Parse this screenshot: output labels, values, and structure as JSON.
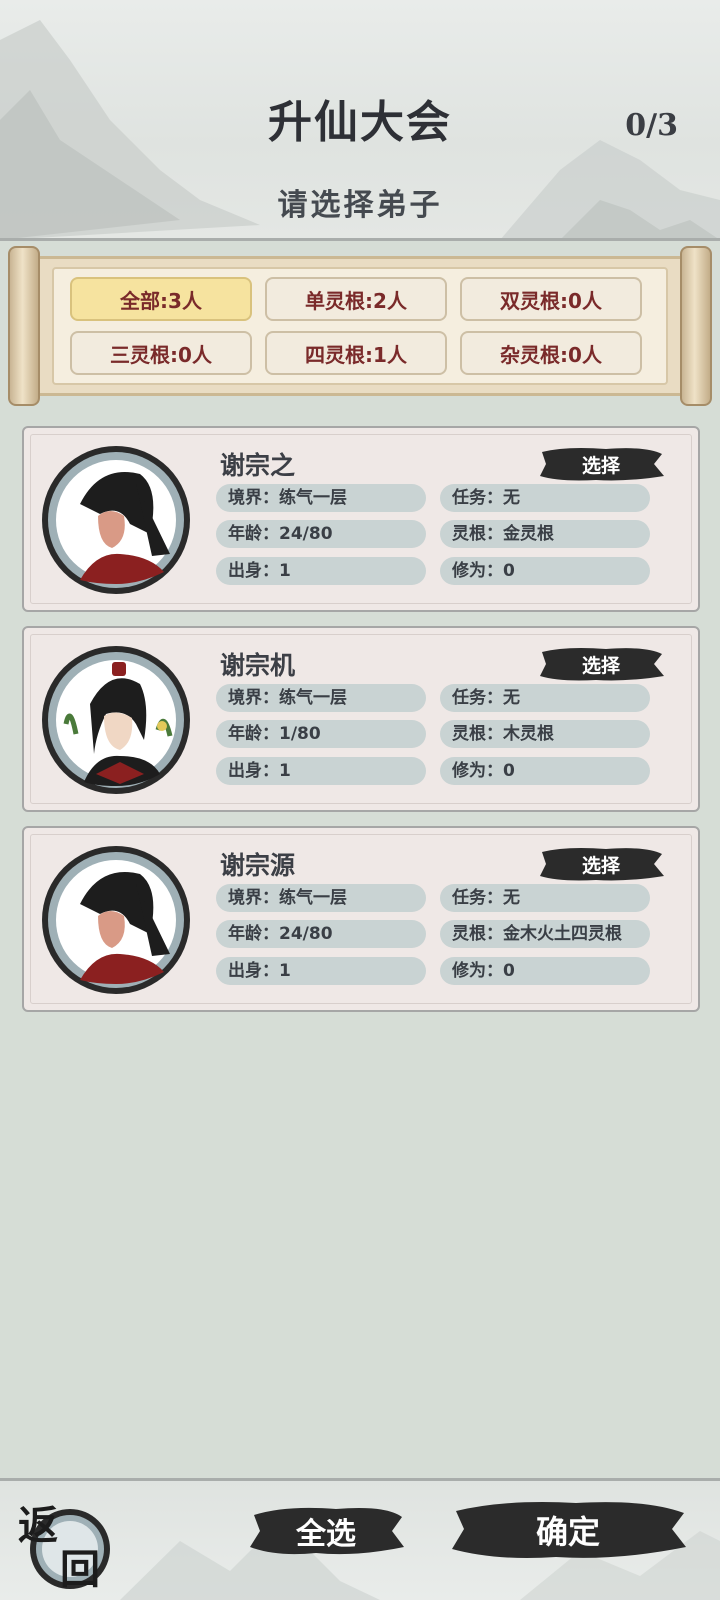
{
  "header": {
    "title": "升仙大会",
    "counter": "0/3",
    "subtitle": "请选择弟子"
  },
  "filters": [
    {
      "label": "全部:3人",
      "active": true
    },
    {
      "label": "单灵根:2人",
      "active": false
    },
    {
      "label": "双灵根:0人",
      "active": false
    },
    {
      "label": "三灵根:0人",
      "active": false
    },
    {
      "label": "四灵根:1人",
      "active": false
    },
    {
      "label": "杂灵根:0人",
      "active": false
    }
  ],
  "disciples": [
    {
      "name": "谢宗之",
      "select_label": "选择",
      "realm": "境界：练气一层",
      "task": "任务：无",
      "age": "年龄：24/80",
      "root": "灵根：金灵根",
      "origin": "出身：1",
      "cultivation": "修为：0"
    },
    {
      "name": "谢宗机",
      "select_label": "选择",
      "realm": "境界：练气一层",
      "task": "任务：无",
      "age": "年龄：1/80",
      "root": "灵根：木灵根",
      "origin": "出身：1",
      "cultivation": "修为：0"
    },
    {
      "name": "谢宗源",
      "select_label": "选择",
      "realm": "境界：练气一层",
      "task": "任务：无",
      "age": "年龄：24/80",
      "root": "灵根：金木火土四灵根",
      "origin": "出身：1",
      "cultivation": "修为：0"
    }
  ],
  "footer": {
    "back_char1": "返",
    "back_char2": "回",
    "select_all": "全选",
    "confirm": "确定"
  },
  "colors": {
    "background": "#d6ddd6",
    "active_filter": "#f6e39f",
    "filter_text": "#7a2a2a",
    "ink_button": "#2b2b2b",
    "pill": "#c9d3d3"
  }
}
